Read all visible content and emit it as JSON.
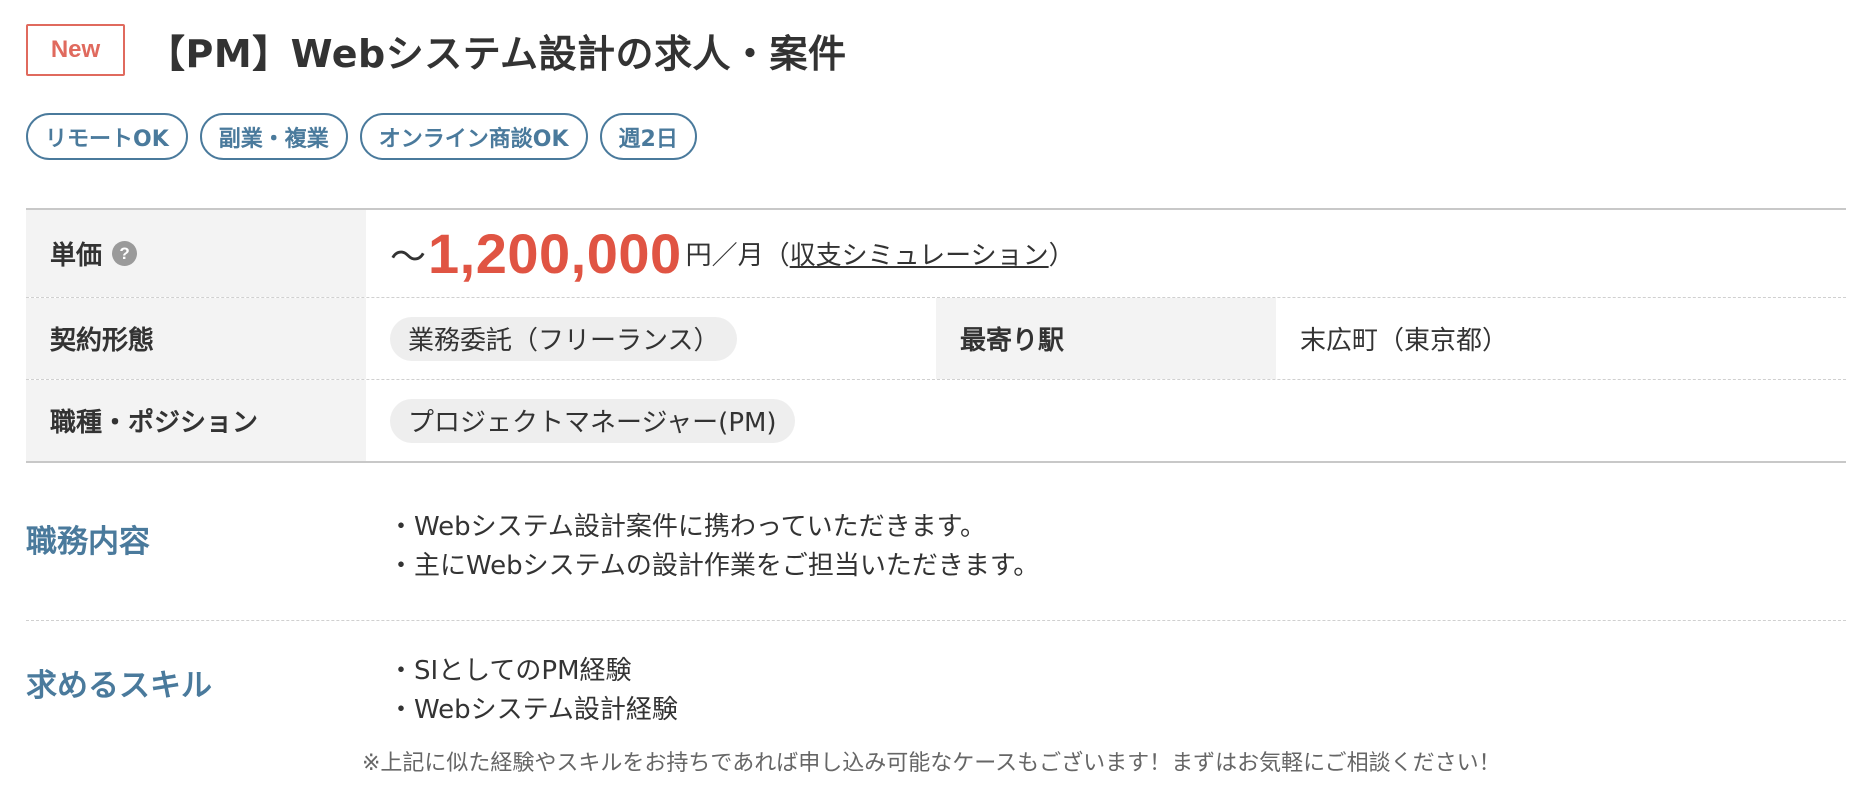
{
  "header": {
    "badge": "New",
    "title": "【PM】Webシステム設計の求人・案件"
  },
  "tags": [
    "リモートOK",
    "副業・複業",
    "オンライン商談OK",
    "週2日"
  ],
  "spec": {
    "price": {
      "label": "単価",
      "help_icon": "?",
      "prefix": "〜",
      "amount": "1,200,000",
      "unit": "円／月（",
      "link": "収支シミュレーション",
      "suffix": "）"
    },
    "contract": {
      "label": "契約形態",
      "value": "業務委託（フリーランス）"
    },
    "station": {
      "label": "最寄り駅",
      "value": "末広町（東京都）"
    },
    "role": {
      "label": "職種・ポジション",
      "value": "プロジェクトマネージャー(PM)"
    }
  },
  "duties": {
    "label": "職務内容",
    "items": [
      "・Webシステム設計案件に携わっていただきます。",
      "・主にWebシステムの設計作業をご担当いただきます。"
    ]
  },
  "skills": {
    "label": "求めるスキル",
    "items": [
      "・SIとしてのPM経験",
      "・Webシステム設計経験"
    ],
    "note": "※上記に似た経験やスキルをお持ちであれば申し込み可能なケースもございます！まずはお気軽にご相談ください！"
  },
  "colors": {
    "accent_red": "#e05443",
    "accent_blue": "#4a7a9c",
    "badge_red": "#e06a5e"
  }
}
